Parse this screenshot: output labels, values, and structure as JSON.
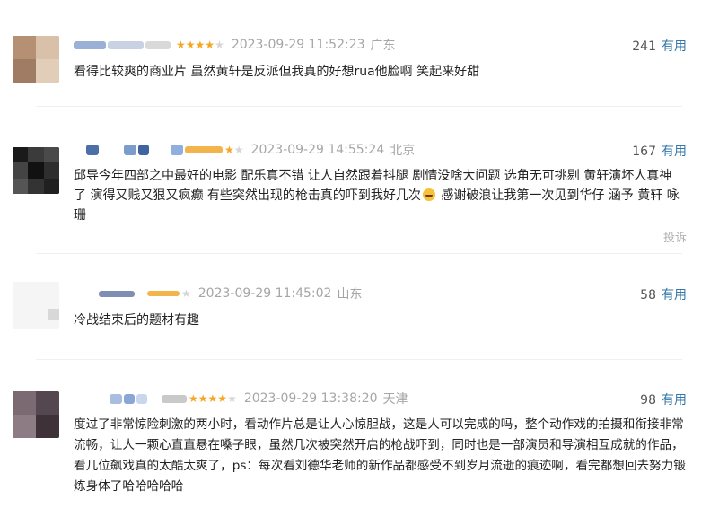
{
  "comments": [
    {
      "date": "2023-09-29 11:52:23",
      "location": "广东",
      "useful_count": "241",
      "useful_label": "有用",
      "rating": 4,
      "content": "看得比较爽的商业片 虽然黄轩是反派但我真的好想rua他脸啊 笑起来好甜"
    },
    {
      "date": "2023-09-29 14:55:24",
      "location": "北京",
      "useful_count": "167",
      "useful_label": "有用",
      "rating": 4,
      "content_a": "邱导今年四部之中最好的电影 配乐真不错 让人自然跟着抖腿 剧情没啥大问题 选角无可挑剔 黄轩演坏人真神了 演得又贱又狠又疯癫 有些突然出现的枪击真的吓到我好几次",
      "emoji_icon": "laughing-emoji-icon",
      "content_b": " 感谢破浪让我第一次见到华仔 涵予 黄轩 咏珊",
      "report_label": "投诉"
    },
    {
      "date": "2023-09-29 11:45:02",
      "location": "山东",
      "useful_count": "58",
      "useful_label": "有用",
      "rating": 3,
      "content": "冷战结束后的题材有趣"
    },
    {
      "date": "2023-09-29 13:38:20",
      "location": "天津",
      "useful_count": "98",
      "useful_label": "有用",
      "rating": 4,
      "content": "度过了非常惊险刺激的两小时，看动作片总是让人心惊胆战，这是人可以完成的吗，整个动作戏的拍摄和衔接非常流畅，让人一颗心直直悬在嗓子眼，虽然几次被突然开启的枪战吓到，同时也是一部演员和导演相互成就的作品，看几位飙戏真的太酷太爽了，ps：每次看刘德华老师的新作品都感受不到岁月流逝的痕迹啊，看完都想回去努力锻炼身体了哈哈哈哈哈"
    }
  ],
  "colors": {
    "star_on": "#f5a623",
    "link": "#3377aa",
    "muted": "#a6a6a6"
  }
}
